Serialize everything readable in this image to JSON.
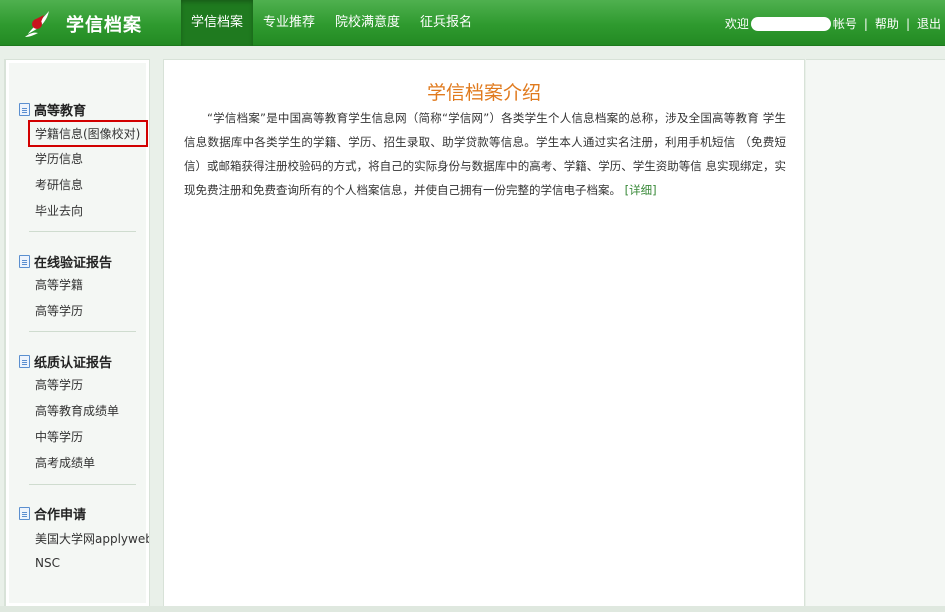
{
  "header": {
    "brand": "学信档案",
    "nav": [
      "学信档案",
      "专业推荐",
      "院校满意度",
      "征兵报名"
    ],
    "welcome": "欢迎",
    "account": "帐号",
    "help": "帮助",
    "logout": "退出",
    "separator": "|"
  },
  "sidebar": {
    "groups": [
      {
        "title": "高等教育",
        "items": [
          "学籍信息(图像校对)",
          "学历信息",
          "考研信息",
          "毕业去向"
        ]
      },
      {
        "title": "在线验证报告",
        "items": [
          "高等学籍",
          "高等学历"
        ]
      },
      {
        "title": "纸质认证报告",
        "items": [
          "高等学历",
          "高等教育成绩单",
          "中等学历",
          "高考成绩单"
        ]
      },
      {
        "title": "合作申请",
        "items": [
          "美国大学网applyweb",
          "NSC"
        ]
      }
    ]
  },
  "main": {
    "title": "学信档案介绍",
    "text": "“学信档案”是中国高等教育学生信息网（简称“学信网”）各类学生个人信息档案的总称，涉及全国高等教育 学生信息数据库中各类学生的学籍、学历、招生录取、助学贷款等信息。学生本人通过实名注册，利用手机短信 （免费短信）或邮箱获得注册校验码的方式，将自己的实际身份与数据库中的高考、学籍、学历、学生资助等信 息实现绑定，实现免费注册和免费查询所有的个人档案信息，并使自己拥有一份完整的学信电子档案。",
    "more": "[详细]"
  },
  "colors": {
    "header_green": "#2f9a2f",
    "title_orange": "#e07a1e",
    "highlight_red": "#d20000",
    "link_green": "#3a8a3a"
  },
  "icons": [
    "logo-icon",
    "document-icon"
  ]
}
